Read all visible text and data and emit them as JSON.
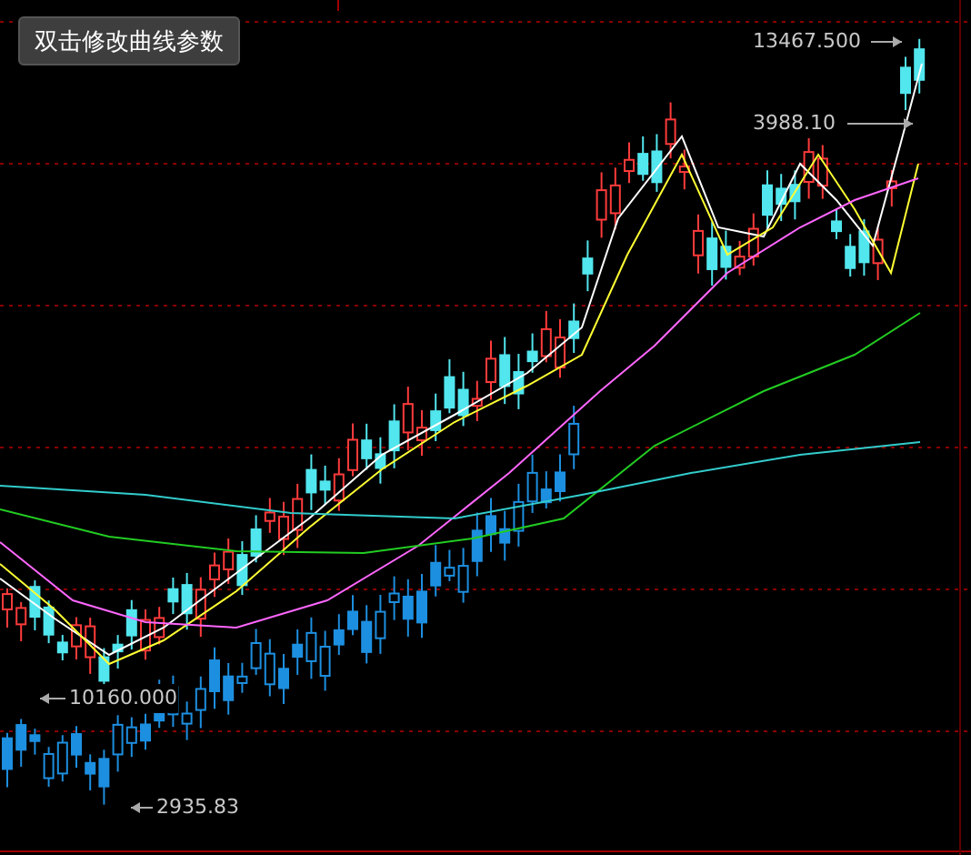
{
  "chart_button": {
    "label": "双击修改曲线参数"
  },
  "chart": {
    "price_labels": [
      {
        "text": "13467.500",
        "kind": "points-right"
      },
      {
        "text": "3988.10",
        "kind": "points-right"
      },
      {
        "text": "10160.000",
        "kind": "points-left"
      },
      {
        "text": "2935.83",
        "kind": "points-left"
      }
    ]
  }
}
